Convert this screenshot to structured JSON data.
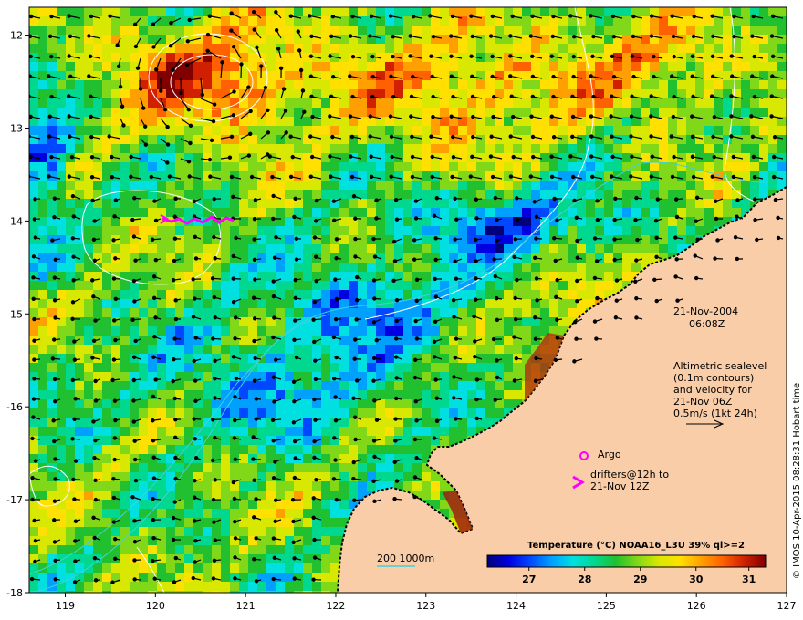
{
  "map": {
    "x_axis": {
      "ticks": [
        "119",
        "120",
        "121",
        "122",
        "123",
        "124",
        "125",
        "126",
        "127"
      ]
    },
    "y_axis": {
      "ticks": [
        "-12",
        "-13",
        "-14",
        "-15",
        "-16",
        "-17",
        "-18"
      ]
    },
    "lon_range": [
      118.6,
      127.0
    ],
    "lat_range": [
      -18.0,
      -11.7
    ]
  },
  "annotations": {
    "date": "21-Nov-2004",
    "time": "06:08Z",
    "alt_lines": [
      "Altimetric sealevel",
      "(0.1m contours)",
      "and velocity for",
      "21-Nov 06Z",
      "0.5m/s (1kt 24h)"
    ],
    "argo_label": "Argo",
    "drifters_lines": [
      "drifters@12h to",
      "21-Nov 12Z"
    ],
    "bathymetry_label": "200  1000m"
  },
  "colorbar": {
    "title": "Temperature (°C) NOAA16_L3U 39% ql>=2",
    "ticks": [
      "27",
      "28",
      "29",
      "30",
      "31"
    ],
    "colors": [
      "#00007a",
      "#0000e0",
      "#0048ff",
      "#00a0ff",
      "#00e0e0",
      "#00d890",
      "#20c030",
      "#80d818",
      "#d8e800",
      "#ffe000",
      "#ffa000",
      "#ff6000",
      "#d02000",
      "#800000"
    ]
  },
  "credit": "© IMOS 10-Apr-2015 08:28:31 Hobart time",
  "colors": {
    "land": "#f9cda8",
    "argo_marker": "#ff00ff",
    "drifter_track": "#ff00ff",
    "contour": "#ffffff",
    "bathymetry": "#40d0e0"
  }
}
